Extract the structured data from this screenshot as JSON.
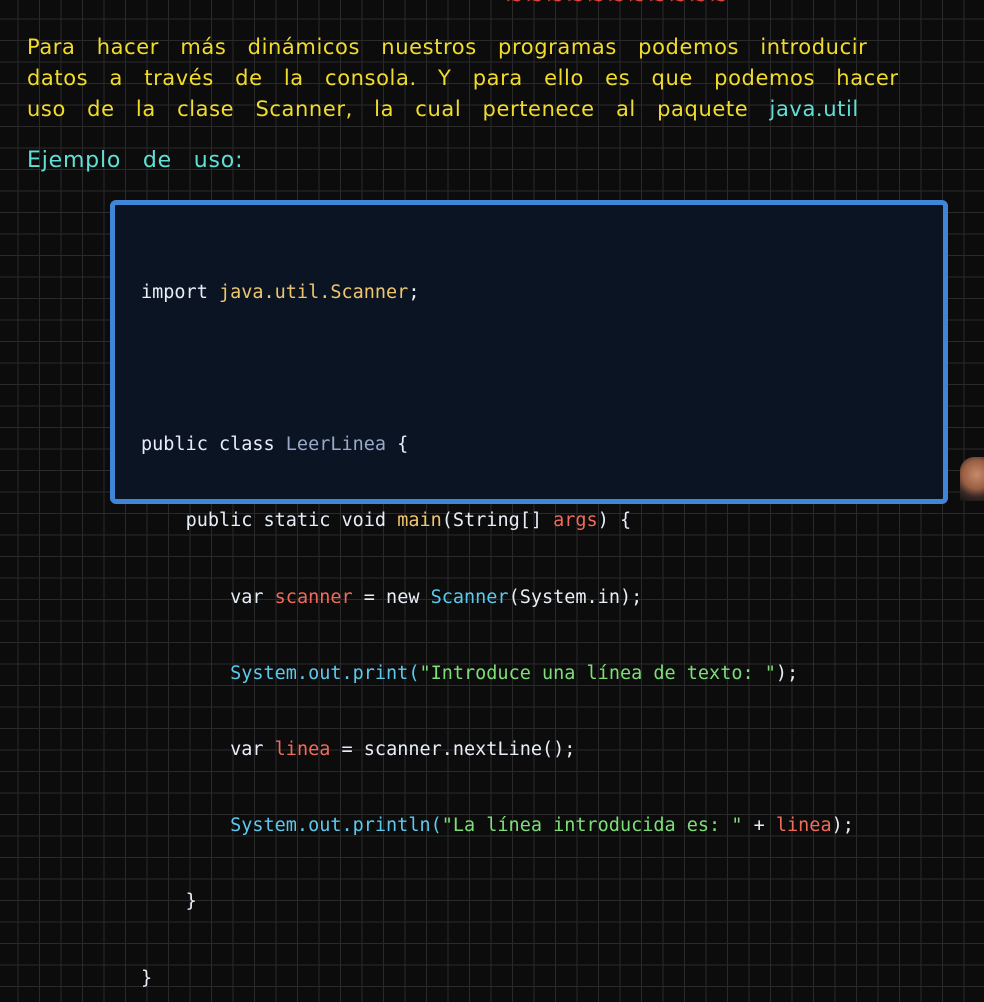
{
  "note": {
    "lines": [
      "Para hacer más dinámicos nuestros programas podemos introducir",
      "datos a través de la consola. Y para ello es que podemos hacer",
      "uso de la clase Scanner, la cual pertenece al paquete"
    ],
    "package_name": "java.util"
  },
  "example_heading": "Ejemplo de uso:",
  "code": {
    "line1": {
      "kw": "import",
      "pkg": "java.util.Scanner",
      "end": ";"
    },
    "line3": {
      "kw": "public class",
      "cls": "LeerLinea",
      "end": " {"
    },
    "line4": {
      "kw": "public static void",
      "fn": "main",
      "params": "(String[] ",
      "arg": "args",
      "end": ") {"
    },
    "line5": {
      "kw": "var",
      "var": "scanner",
      "op": " = new ",
      "typ": "Scanner",
      "arg": "(System.in);"
    },
    "line6": {
      "call": "System.out.print(",
      "str": "\"Introduce una línea de texto: \"",
      "end": ");"
    },
    "line7": {
      "kw": "var",
      "var": "linea",
      "op": " = scanner.nextLine();"
    },
    "line8": {
      "call": "System.out.println(",
      "str": "\"La línea introducida es: \"",
      "op": " + ",
      "var": "linea",
      "end": ");"
    },
    "line9": "}",
    "line10": "}"
  }
}
